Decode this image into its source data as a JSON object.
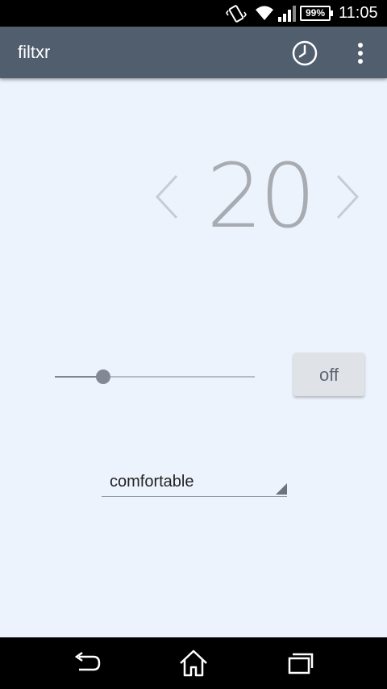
{
  "status_bar": {
    "battery_percent": "99%",
    "time": "11:05",
    "icons": [
      "vibrate-icon",
      "wifi-icon",
      "signal-icon",
      "battery-icon"
    ]
  },
  "app_bar": {
    "title": "filtxr",
    "actions": [
      "clock-icon",
      "overflow-menu-icon"
    ]
  },
  "intensity": {
    "value": "20",
    "prev_icon": "chevron-left-icon",
    "next_icon": "chevron-right-icon"
  },
  "slider": {
    "level": 0.24
  },
  "toggle": {
    "label": "off"
  },
  "mode_spinner": {
    "selected": "comfortable"
  },
  "nav_bar": {
    "icons": [
      "back-icon",
      "home-icon",
      "recents-icon"
    ]
  },
  "colors": {
    "app_bar": "#515e6e",
    "background": "#edf3fd",
    "value_text": "#a8acb2"
  }
}
